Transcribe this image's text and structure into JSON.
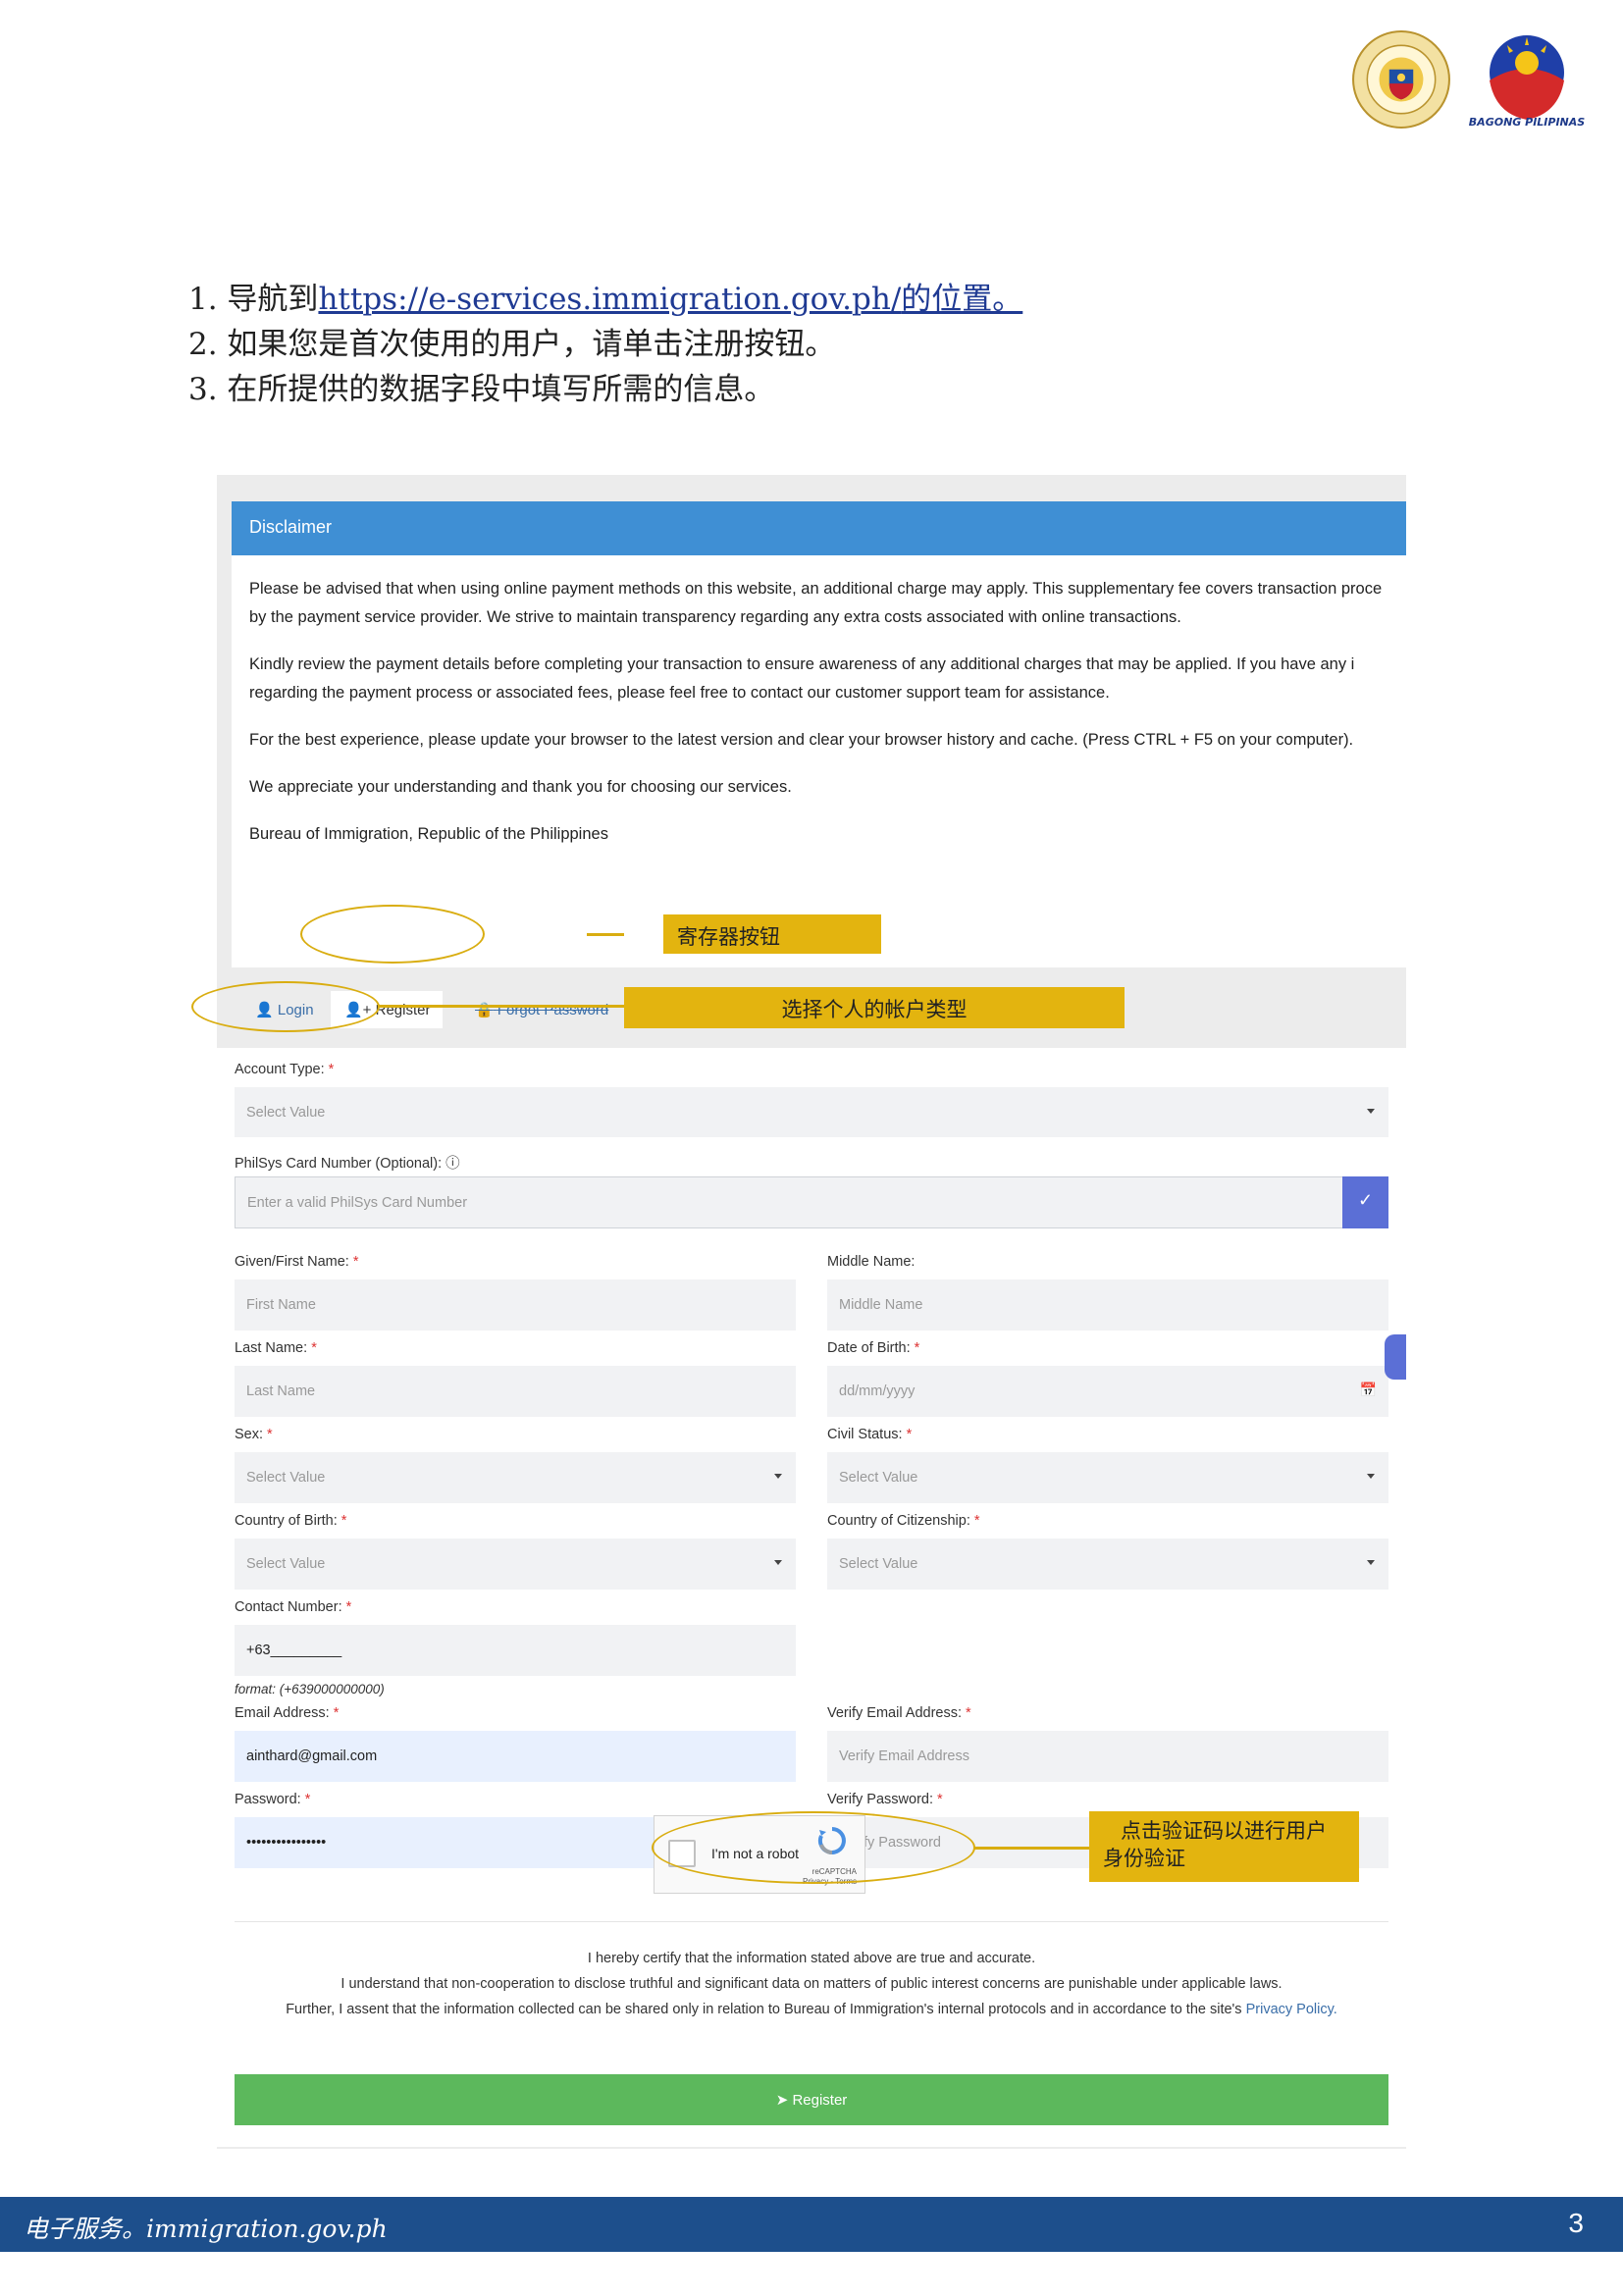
{
  "logos": {
    "bagong_pilipinas": "BAGONG PILIPINAS"
  },
  "steps": {
    "s1_prefix": "1. 导航到",
    "s1_url": "https://e-services.immigration.gov.ph/",
    "s1_suffix": "的位置。",
    "s2": "2. 如果您是首次使用的用户，请单击注册按钮。",
    "s3": "3. 在所提供的数据字段中填写所需的信息。"
  },
  "disclaimer": {
    "title": "Disclaimer",
    "p1a": "Please be advised that when using online payment methods on this website, an additional charge may apply. This supplementary fee covers transaction proce",
    "p1b": "by the payment service provider. We strive to maintain transparency regarding any extra costs associated with online transactions.",
    "p2a": "Kindly review the payment details before completing your transaction to ensure awareness of any additional charges that may be applied. If you have any i",
    "p2b": "regarding the payment process or associated fees, please feel free to contact our customer support team for assistance.",
    "p3": "For the best experience, please update your browser to the latest version and clear your browser history and cache. (Press CTRL + F5 on your computer).",
    "p4": "We appreciate your understanding and thank you for choosing our services.",
    "p5": "Bureau of Immigration, Republic of the Philippines"
  },
  "tabs": {
    "login": "Login",
    "register": "Register",
    "forgot": "Forgot Password"
  },
  "form": {
    "account_type_label": "Account Type:",
    "account_type_value": "Select Value",
    "philsys_label": "PhilSys Card Number (Optional):",
    "philsys_placeholder": "Enter a valid PhilSys Card Number",
    "first_name_label": "Given/First Name:",
    "first_name_placeholder": "First Name",
    "middle_name_label": "Middle Name:",
    "middle_name_placeholder": "Middle Name",
    "last_name_label": "Last Name:",
    "last_name_placeholder": "Last Name",
    "dob_label": "Date of Birth:",
    "dob_placeholder": "dd/mm/yyyy",
    "sex_label": "Sex:",
    "sex_value": "Select Value",
    "civil_label": "Civil Status:",
    "civil_value": "Select Value",
    "cob_label": "Country of Birth:",
    "cob_value": "Select Value",
    "coc_label": "Country of Citizenship:",
    "coc_value": "Select Value",
    "contact_label": "Contact Number:",
    "contact_value": "+63_________",
    "contact_format": "format: (+639000000000)",
    "email_label": "Email Address:",
    "email_value": "ainthard@gmail.com",
    "verify_email_label": "Verify Email Address:",
    "verify_email_placeholder": "Verify Email Address",
    "password_label": "Password:",
    "password_value": "••••••••••••••••",
    "verify_password_label": "Verify Password:",
    "verify_password_placeholder": "Verify Password",
    "required_mark": "*"
  },
  "recaptcha": {
    "label": "I'm not a robot",
    "brand": "reCAPTCHA",
    "links": "Privacy - Terms"
  },
  "certify": {
    "line1": "I hereby certify that the information stated above are true and accurate.",
    "line2": "I understand that non-cooperation to disclose truthful and significant data on matters of public interest concerns are punishable under applicable laws.",
    "line3": "Further, I assent that the information collected can be shared only in relation to Bureau of Immigration's internal protocols and in accordance to the site's",
    "privacy": "Privacy Policy."
  },
  "register_button": "Register",
  "annotations": {
    "register_tab": "寄存器按钮",
    "account_type": "选择个人的帐户类型",
    "captcha_l1": "点击验证码以进行用户",
    "captcha_l2": "身份验证"
  },
  "footer": {
    "text": "电子服务。immigration.gov.ph",
    "page": "3"
  },
  "colors": {
    "header_blue": "#3f8fd4",
    "register_green": "#5cb85c",
    "callout_gold": "#e3b40f",
    "footer_blue": "#1d4f8c"
  }
}
